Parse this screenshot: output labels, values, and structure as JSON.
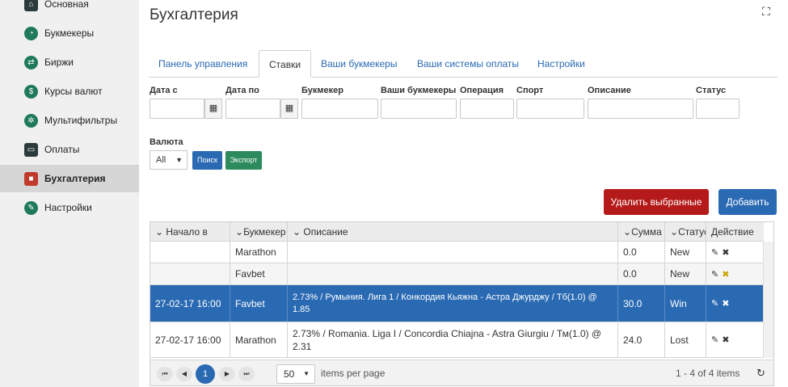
{
  "sidebar": {
    "items": [
      {
        "label": "Основная",
        "icon": "home-icon"
      },
      {
        "label": "Букмекеры",
        "icon": "clock-icon"
      },
      {
        "label": "Биржи",
        "icon": "exchange-icon"
      },
      {
        "label": "Курсы валют",
        "icon": "currency-icon"
      },
      {
        "label": "Мультифильтры",
        "icon": "filter-icon"
      },
      {
        "label": "Оплаты",
        "icon": "card-icon"
      },
      {
        "label": "Бухгалтерия",
        "icon": "briefcase-icon"
      },
      {
        "label": "Настройки",
        "icon": "settings-icon"
      }
    ]
  },
  "page": {
    "title": "Бухгалтерия"
  },
  "tabs": [
    {
      "label": "Панель управления"
    },
    {
      "label": "Ставки"
    },
    {
      "label": "Ваши букмекеры"
    },
    {
      "label": "Ваши системы оплаты"
    },
    {
      "label": "Настройки"
    }
  ],
  "filters": {
    "date_from": "Дата с",
    "date_to": "Дата по",
    "bookmaker": "Букмекер",
    "your_bookmakers": "Ваши букмекеры",
    "operation": "Операция",
    "sport": "Спорт",
    "description": "Описание",
    "status": "Статус",
    "currency": "Валюта",
    "currency_value": "All",
    "search_button": "Поиск",
    "export_button": "Экспорт"
  },
  "actions": {
    "delete_selected": "Удалить выбранные",
    "add": "Добавить"
  },
  "colors": {
    "primary": "#2a6ab3",
    "danger": "#b51a1a",
    "success": "#2c8a5c"
  },
  "grid": {
    "headers": [
      "Начало в",
      "Букмекер",
      "Описание",
      "Сумма",
      "Статус",
      "Действие"
    ],
    "rows": [
      {
        "start": "",
        "bookmaker": "Marathon",
        "description": "",
        "amount": "0.0",
        "status": "New",
        "selected": false
      },
      {
        "start": "",
        "bookmaker": "Favbet",
        "description": "",
        "amount": "0.0",
        "status": "New",
        "selected": false
      },
      {
        "start": "27-02-17 16:00",
        "bookmaker": "Favbet",
        "description": "2.73% / Румыния. Лига 1 / Конкордия Кьяжна - Астра Джурджу / Тб(1.0) @ 1.85",
        "amount": "30.0",
        "status": "Win",
        "selected": true
      },
      {
        "start": "27-02-17 16:00",
        "bookmaker": "Marathon",
        "description": "2.73% / Romania. Liga I / Concordia Chiajna - Astra Giurgiu / Тм(1.0) @ 2.31",
        "amount": "24.0",
        "status": "Lost",
        "selected": false
      }
    ],
    "pager": {
      "current_page": "1",
      "page_size": "50",
      "items_per_page": "items per page",
      "summary": "1 - 4 of 4 items"
    }
  }
}
